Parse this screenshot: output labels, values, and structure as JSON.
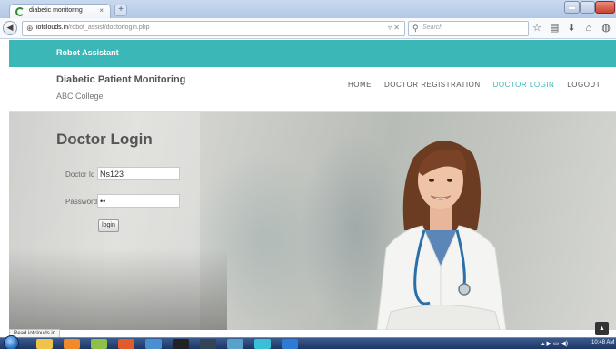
{
  "browser": {
    "tab_title": "diabetic monitoring",
    "tab_close": "×",
    "new_tab": "+",
    "url_domain": "iotclouds.in",
    "url_path": "/robot_assist/doctorlogin.php",
    "url_icons": "▿ ✕",
    "search_placeholder": "Search",
    "toolbar_icons": [
      "star-icon",
      "clipboard-icon",
      "download-icon",
      "home-icon",
      "shield-icon",
      "menu-icon"
    ],
    "status_text": "Read iotclouds.in"
  },
  "site": {
    "brand": "Robot Assistant",
    "title": "Diabetic Patient Monitoring",
    "subtitle": "ABC College",
    "nav": [
      {
        "label": "HOME",
        "active": false
      },
      {
        "label": "DOCTOR REGISTRATION",
        "active": false
      },
      {
        "label": "DOCTOR LOGIN",
        "active": true
      },
      {
        "label": "LOGOUT",
        "active": false
      }
    ],
    "accent_color": "#3bb7b7"
  },
  "login": {
    "heading": "Doctor Login",
    "doctor_id_label": "Doctor Id",
    "doctor_id_value": "Ns123",
    "password_label": "Password",
    "password_value": "••",
    "button_label": "login"
  },
  "taskbar": {
    "clock": "10:48 AM",
    "tray_icons": "▴ ▶ ▭ ◀)"
  }
}
